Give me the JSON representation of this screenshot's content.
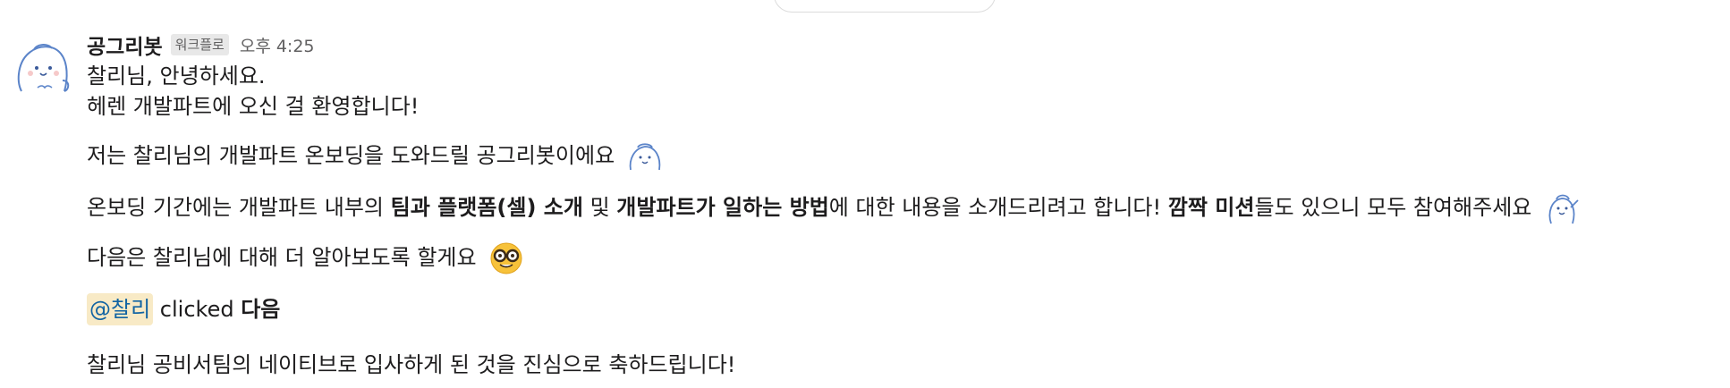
{
  "message": {
    "sender": "공그리봇",
    "app_badge": "워크플로",
    "timestamp": "오후 4:25",
    "avatar_icon": "robot-mascot-icon",
    "lines": {
      "l1": "찰리님, 안녕하세요.",
      "l2": "헤렌 개발파트에 오신 걸 환영합니다!",
      "l3": "저는 찰리님의 개발파트 온보딩을 도와드릴 공그리봇이에요",
      "l4_a": "온보딩 기간에는 개발파트 내부의 ",
      "l4_b": "팀과 플랫폼(셀) 소개",
      "l4_c": " 및 ",
      "l4_d": "개발파트가 일하는 방법",
      "l4_e": "에 대한 내용을 소개드리려고 합니다! ",
      "l4_f": "깜짝 미션",
      "l4_g": "들도 있으니 모두 참여해주세요",
      "l5": "다음은 찰리님에 대해 더 알아보도록 할게요",
      "l6_mention": "@찰리",
      "l6_text": " clicked ",
      "l6_bold": "다음",
      "l7": "찰리님 공비서팀의 네이티브로 입사하게 된 것을 진심으로 축하드립니다!"
    },
    "emoji": {
      "e1": "custom-mascot-emoji-icon",
      "e2": "custom-mascot-salute-emoji-icon",
      "e3": "nerd-face-emoji-icon"
    }
  }
}
